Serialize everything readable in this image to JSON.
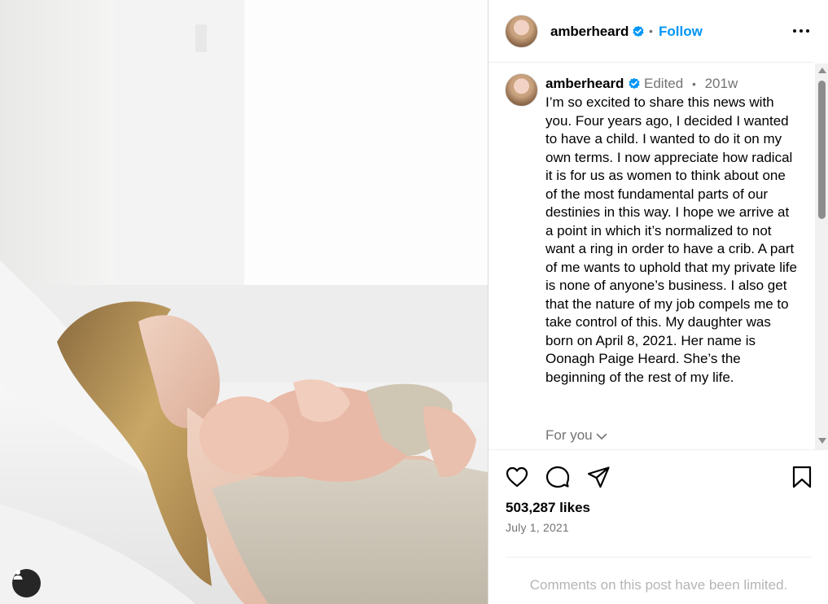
{
  "post": {
    "username": "amberheard",
    "follow_label": "Follow",
    "separator": "•",
    "edited_label": "Edited",
    "age": "201w",
    "caption": "I’m so excited to share this news with you. Four years ago, I decided I wanted to have a child. I wanted to do it on my own terms. I now appreciate how radical it is for us as women to think about one of the most fundamental parts of our destinies in this way. I hope we arrive at a point in which it’s normalized to not want a ring in order to have a crib. A part of me wants to uphold that my private life is none of anyone’s business. I also get that the nature of my job compels me to take control of this. My daughter was born on April 8, 2021. Her name is Oonagh Paige Heard. She’s the beginning of the rest of my life.",
    "for_you_label": "For you",
    "likes": "503,287 likes",
    "date": "July 1, 2021",
    "comments_notice": "Comments on this post have been limited."
  },
  "icons": {
    "verified": "verified-badge-icon",
    "more": "more-options-icon",
    "like": "heart-icon",
    "comment": "comment-icon",
    "share": "share-icon",
    "save": "bookmark-icon",
    "tags": "user-tag-icon",
    "chevron": "chevron-down-icon"
  },
  "colors": {
    "link_blue": "#0095f6",
    "secondary_text": "#737373",
    "muted_text": "#b5b5b5",
    "verified_blue": "#0095f6"
  }
}
